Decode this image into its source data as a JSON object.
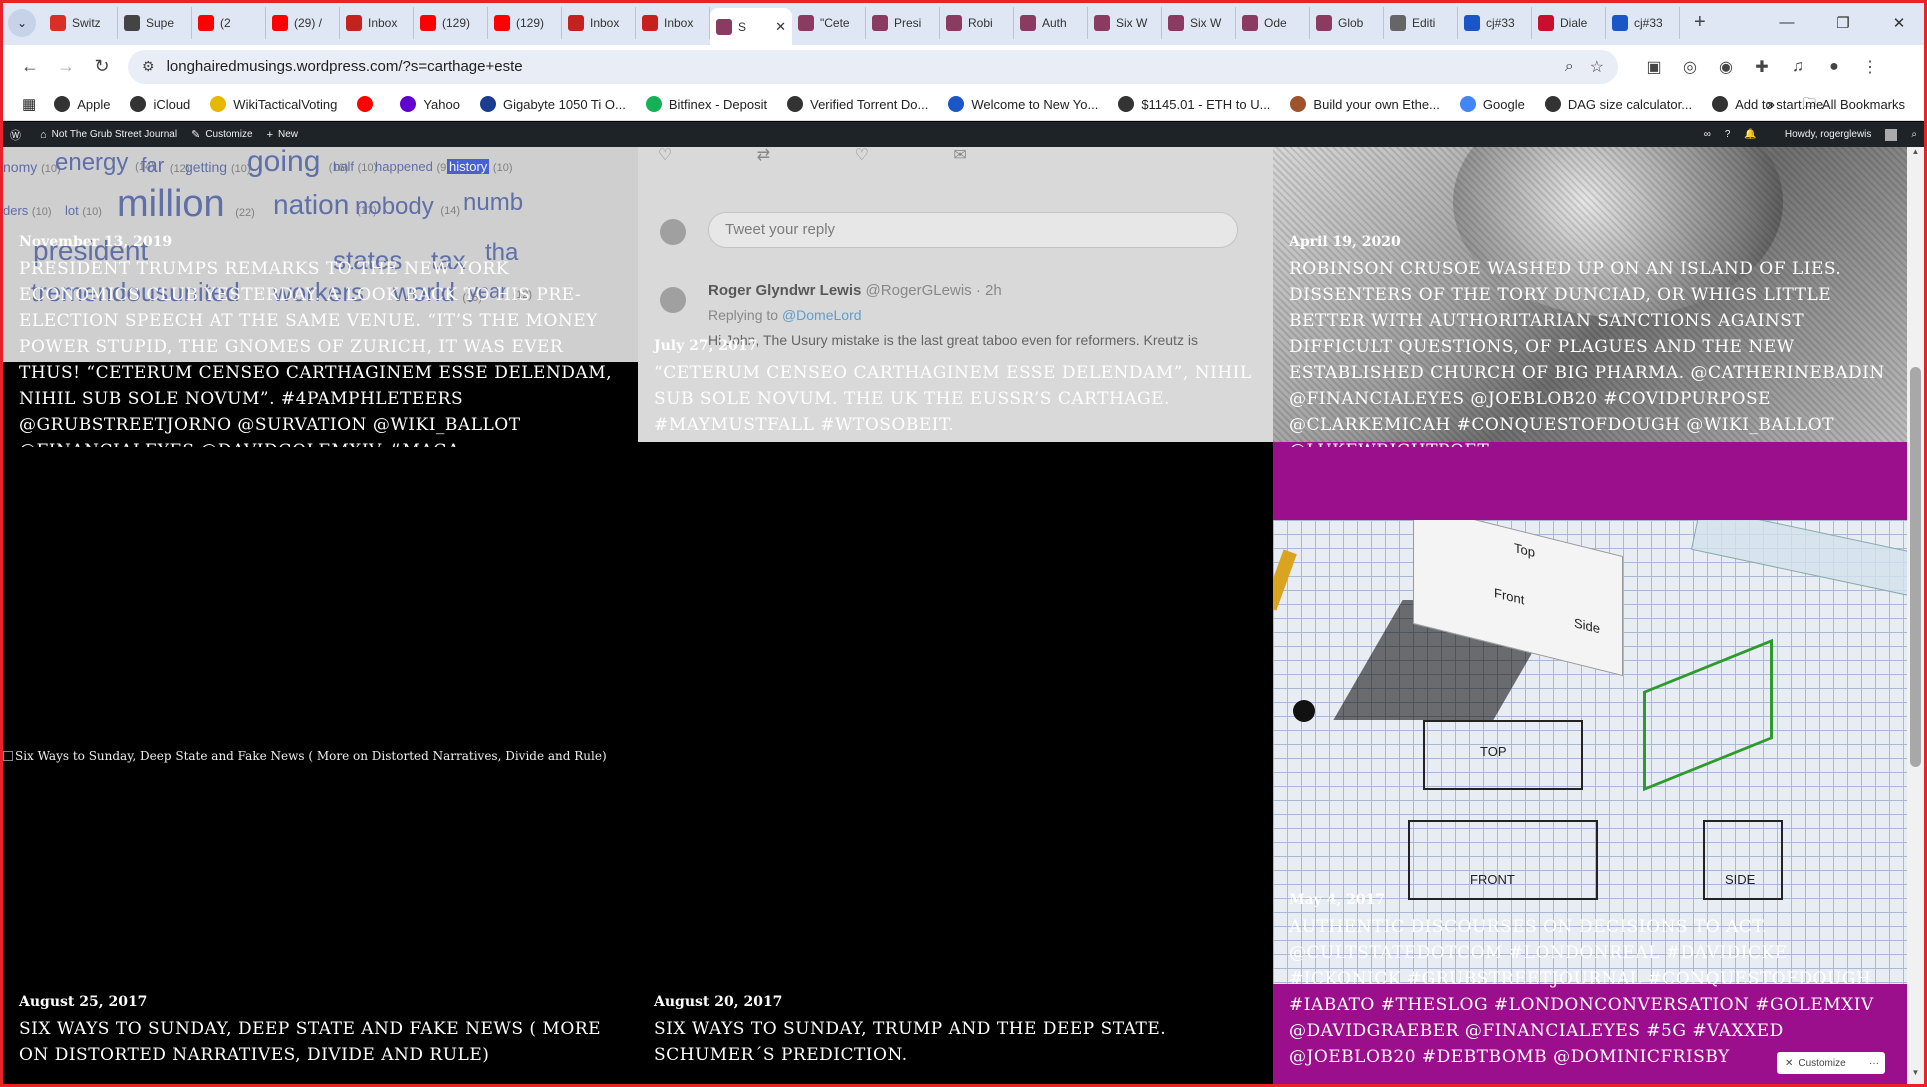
{
  "tabs": [
    {
      "title": "Switz",
      "icon": "refresh-icon",
      "color": "#d93025"
    },
    {
      "title": "Supe",
      "icon": "cursor-icon",
      "color": "#444"
    },
    {
      "title": "(2",
      "icon": "youtube-icon",
      "color": "#ff0000"
    },
    {
      "title": "(29) /",
      "icon": "youtube-icon",
      "color": "#ff0000"
    },
    {
      "title": "Inbox",
      "icon": "gmail-icon",
      "color": "#c5221f"
    },
    {
      "title": "(129)",
      "icon": "youtube-icon",
      "color": "#ff0000"
    },
    {
      "title": "(129)",
      "icon": "youtube-icon",
      "color": "#ff0000"
    },
    {
      "title": "Inbox",
      "icon": "gmail-icon",
      "color": "#c5221f"
    },
    {
      "title": "Inbox",
      "icon": "gmail-icon",
      "color": "#c5221f"
    },
    {
      "title": "S",
      "icon": "wordpress-icon",
      "color": "#8b3a62",
      "active": true
    },
    {
      "title": "\"Cete",
      "icon": "wordpress-icon",
      "color": "#8b3a62"
    },
    {
      "title": "Presi",
      "icon": "wordpress-icon",
      "color": "#8b3a62"
    },
    {
      "title": "Robi",
      "icon": "wordpress-icon",
      "color": "#8b3a62"
    },
    {
      "title": "Auth",
      "icon": "wordpress-icon",
      "color": "#8b3a62"
    },
    {
      "title": "Six W",
      "icon": "wordpress-icon",
      "color": "#8b3a62"
    },
    {
      "title": "Six W",
      "icon": "wordpress-icon",
      "color": "#8b3a62"
    },
    {
      "title": "Ode",
      "icon": "wordpress-icon",
      "color": "#8b3a62"
    },
    {
      "title": "Glob",
      "icon": "wordpress-icon",
      "color": "#8b3a62"
    },
    {
      "title": "Editi",
      "icon": "document-icon",
      "color": "#666"
    },
    {
      "title": "cj#33",
      "icon": "bookmark-icon",
      "color": "#1a56c8"
    },
    {
      "title": "Diale",
      "icon": "book-icon",
      "color": "#c8102e"
    },
    {
      "title": "cj#33",
      "icon": "bookmark-icon",
      "color": "#1a56c8"
    }
  ],
  "address": {
    "url": "longhairedmusings.wordpress.com/?s=carthage+este"
  },
  "bookmarks": [
    {
      "label": "Apple",
      "color": "#333"
    },
    {
      "label": "iCloud",
      "color": "#333"
    },
    {
      "label": "WikiTacticalVoting",
      "color": "#e6b800"
    },
    {
      "label": "",
      "color": "#ff0000"
    },
    {
      "label": "Yahoo",
      "color": "#6001d2"
    },
    {
      "label": "Gigabyte 1050 Ti O...",
      "color": "#1a3d8f"
    },
    {
      "label": "Bitfinex - Deposit",
      "color": "#16b157"
    },
    {
      "label": "Verified Torrent Do...",
      "color": "#333"
    },
    {
      "label": "Welcome to New Yo...",
      "color": "#1a56c8"
    },
    {
      "label": "$1145.01 - ETH to U...",
      "color": "#333"
    },
    {
      "label": "Build your own Ethe...",
      "color": "#a0522d"
    },
    {
      "label": "Google",
      "color": "#4285f4"
    },
    {
      "label": "DAG size calculator...",
      "color": "#333"
    },
    {
      "label": "Add to start.me",
      "color": "#333"
    }
  ],
  "all_bookmarks": "All Bookmarks",
  "adminbar": {
    "site": "Not The Grub Street Journal",
    "customize": "Customize",
    "new": "New",
    "howdy": "Howdy, rogerglewis"
  },
  "wordcloud": {
    "words": [
      {
        "w": "nomy",
        "n": "(10)"
      },
      {
        "w": "energy",
        "n": "(14)"
      },
      {
        "w": "far",
        "n": "(12)"
      },
      {
        "w": "getting",
        "n": "(10)"
      },
      {
        "w": "going",
        "n": "(16)"
      },
      {
        "w": "half",
        "n": "(10)"
      },
      {
        "w": "happened",
        "n": "(9)"
      },
      {
        "w": "history",
        "n": "(10)"
      },
      {
        "w": "ders",
        "n": "(10)"
      },
      {
        "w": "lot",
        "n": "(10)"
      },
      {
        "w": "million",
        "n": "(22)"
      },
      {
        "w": "nation",
        "n": "(17)"
      },
      {
        "w": "nobody",
        "n": "(14)"
      },
      {
        "w": "numb",
        "n": ""
      },
      {
        "w": "president",
        "n": ""
      },
      {
        "w": "states",
        "n": ""
      },
      {
        "w": "tax",
        "n": ""
      },
      {
        "w": "tha",
        "n": ""
      },
      {
        "w": "tremendous",
        "n": ""
      },
      {
        "w": "united",
        "n": ""
      },
      {
        "w": "workers",
        "n": ""
      },
      {
        "w": "world",
        "n": "(15)"
      },
      {
        "w": "year",
        "n": "(12)"
      }
    ]
  },
  "tweet": {
    "reply_placeholder": "Tweet your reply",
    "name": "Roger Glyndwr Lewis",
    "handle": "@RogerGLewis · 2h",
    "replying_prefix": "Replying to",
    "replying_to": "@DomeLord",
    "text": "Hi John, The Usury mistake is the last great taboo even for reformers.  Kreutz is"
  },
  "posts": [
    {
      "date": "November 13, 2019",
      "title": "President Trumps Remarks to The New York Economics Club Yesterday. A look back to his pre-election Speech at the same Venue. “It’s the Money Power Stupid, The Gnomes of Zurich, It was ever Thus! “Ceterum censeo Carthaginem esse delendam, Nihil sub sole novum”. #4pamphleteers @GrubStreetJorno @Survation @WIKI_Ballot @financialeyes @DavidGolemXIV #MAGA"
    },
    {
      "date": "July 27, 2017",
      "title": "“Ceterum censeo Carthaginem esse delendam”, Nihil sub sole novum. The UK the EUSSR’s Carthage. #MayMustFall #WTOsobeit."
    },
    {
      "date": "April 19, 2020",
      "title": "Robinson Crusoe washed up on an Island of Lies. Dissenters of the Tory Dunciad, or Whigs little better with Authoritarian Sanctions against difficult questions, of Plagues and the new established Church of Big Pharma. @CatherineBadin @financialeyes @joeblob20 #CovidPurpose @ClarkeMicah #ConquestofDough @WIKI_Ballot @LukeWrightPoet"
    },
    {
      "date": "August 25, 2017",
      "title": "Six Ways to Sunday, Deep State and Fake News ( More on Distorted Narratives, Divide and Rule)"
    },
    {
      "date": "August 20, 2017",
      "title": "Six Ways to Sunday, Trump and the Deep State. Schumer´s Prediction."
    },
    {
      "date": "May 4, 2017",
      "title": "Authentic Discourses on Decisions to act. @cultstatedotcom #LondonReal #DavidIcke #IckoNick #GrubStreetJournal #ConquestofDough #IaBato #TheSlog #LondonConversation #GolemXIV @davidgraeber @financialeyes #5G #Vaxxed @joeblob20 #DebtBomb @dominicfrisby"
    }
  ],
  "broken_image_alt": "Six Ways to Sunday, Deep State and Fake News ( More on Distorted Narratives, Divide and Rule)",
  "sketch_labels": {
    "top": "TOP",
    "front": "FRONT",
    "side": "SIDE",
    "box_top": "Top",
    "box_front": "Front",
    "box_side": "Side"
  },
  "customize_chip": "Customize",
  "colors": {
    "magenta": "#9c0f8c",
    "admin_bar": "#1d2327",
    "frame": "#e8212b"
  }
}
